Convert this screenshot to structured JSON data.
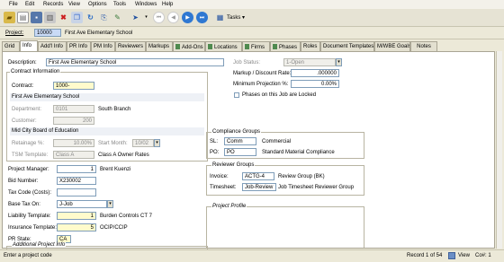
{
  "menu": [
    "File",
    "Edit",
    "Records",
    "View",
    "Options",
    "Tools",
    "Windows",
    "Help"
  ],
  "toolbar": {
    "tasks_label": "Tasks"
  },
  "project": {
    "label": "Project:",
    "code": "10000",
    "name": "First Ave Elementary School"
  },
  "tabs": [
    "Grid",
    "Info",
    "Add'l Info",
    "PR Info",
    "PM Info",
    "Reviewers",
    "Markups",
    "Add-Ons",
    "Locations",
    "Firms",
    "Phases",
    "Roles",
    "Document Templates",
    "M/WBE Goals",
    "Notes"
  ],
  "form": {
    "description_label": "Description:",
    "description": "First Ave Elementary School",
    "contract_group": "Contract Information",
    "contract_label": "Contract:",
    "contract": "1000-",
    "contract_desc": "First Ave Elementary School",
    "department_label": "Department:",
    "department": "0101",
    "department_desc": "South Branch",
    "customer_label": "Customer:",
    "customer": "200",
    "customer_desc": "Mid City Board of Education",
    "retainage_label": "Retainage %:",
    "retainage": "10.00%",
    "start_month_label": "Start Month:",
    "start_month": "10/02",
    "tsm_label": "TSM Template:",
    "tsm": "Class A",
    "tsm_desc": "Class A Owner Rates",
    "pm_label": "Project Manager:",
    "pm": "1",
    "pm_desc": "Brent Kuenzi",
    "bid_label": "Bid Number:",
    "bid": "X230002",
    "taxcode_label": "Tax Code (Costs):",
    "taxcode": "",
    "basetax_label": "Base Tax On:",
    "basetax": "J-Job",
    "liability_label": "Liability Template:",
    "liability": "1",
    "liability_desc": "Burden Controls CT 7",
    "insurance_label": "Insurance Template:",
    "insurance": "5",
    "insurance_desc": "OCIP/CCIP",
    "prstate_label": "PR State:",
    "prstate": "CA",
    "addl_label": "Additional Project Info",
    "jobstatus_label": "Job Status:",
    "jobstatus": "1-Open",
    "markup_label": "Markup / Discount Rate:",
    "markup": ".000000",
    "minproj_label": "Minimum Projection %:",
    "minproj": "0.00%",
    "phases_locked": "Phases on this Job are Locked",
    "compliance_group": "Compliance Groups",
    "sl_label": "SL:",
    "sl": "Comm",
    "sl_desc": "Commercial",
    "po_label": "PO:",
    "po": "PO",
    "po_desc": "Standard Material Compliance",
    "reviewer_group": "Reviewer Groups",
    "invoice_label": "Invoice:",
    "invoice": "ACTG-4",
    "invoice_desc": "Review Group (BK)",
    "timesheet_label": "Timesheet:",
    "timesheet": "Job-Review",
    "timesheet_desc": "Job Timesheet Reviewer Group",
    "profile_label": "Project Profile"
  },
  "status": {
    "hint": "Enter a project code",
    "record": "Record 1 of 54",
    "view": "View",
    "company": "Co#: 1"
  }
}
